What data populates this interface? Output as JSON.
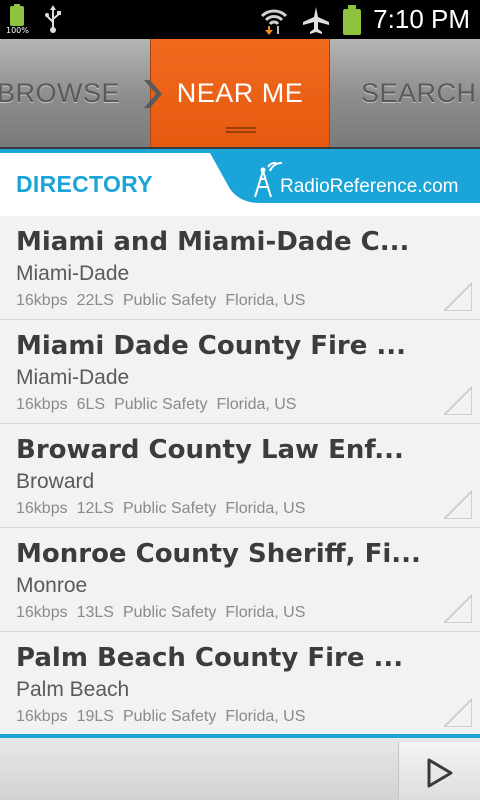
{
  "status_bar": {
    "battery_small_label": "100%",
    "time": "7:10 PM",
    "icons": [
      "battery-icon",
      "usb-icon",
      "wifi-icon",
      "airplane-icon",
      "battery-icon"
    ]
  },
  "tabs": [
    {
      "label": "BROWSE",
      "active": false
    },
    {
      "label": "NEAR ME",
      "active": true
    },
    {
      "label": "SEARCH",
      "active": false
    }
  ],
  "header": {
    "title": "DIRECTORY",
    "logo_text": "RadioReference.com"
  },
  "colors": {
    "accent_blue": "#1ba4d8",
    "active_tab": "#e85e14",
    "battery_green": "#8fc23f"
  },
  "feeds": [
    {
      "title": "Miami and Miami-Dade C...",
      "county": "Miami-Dade",
      "bitrate": "16kbps",
      "listeners": "22LS",
      "genre": "Public Safety",
      "location": "Florida, US"
    },
    {
      "title": "Miami Dade County Fire ...",
      "county": "Miami-Dade",
      "bitrate": "16kbps",
      "listeners": "6LS",
      "genre": "Public Safety",
      "location": "Florida, US"
    },
    {
      "title": "Broward County Law Enf...",
      "county": "Broward",
      "bitrate": "16kbps",
      "listeners": "12LS",
      "genre": "Public Safety",
      "location": "Florida, US"
    },
    {
      "title": "Monroe County Sheriff, Fi...",
      "county": "Monroe",
      "bitrate": "16kbps",
      "listeners": "13LS",
      "genre": "Public Safety",
      "location": "Florida, US"
    },
    {
      "title": "Palm Beach County Fire ...",
      "county": "Palm Beach",
      "bitrate": "16kbps",
      "listeners": "19LS",
      "genre": "Public Safety",
      "location": "Florida, US"
    }
  ],
  "player": {
    "play_icon": "play-icon"
  }
}
